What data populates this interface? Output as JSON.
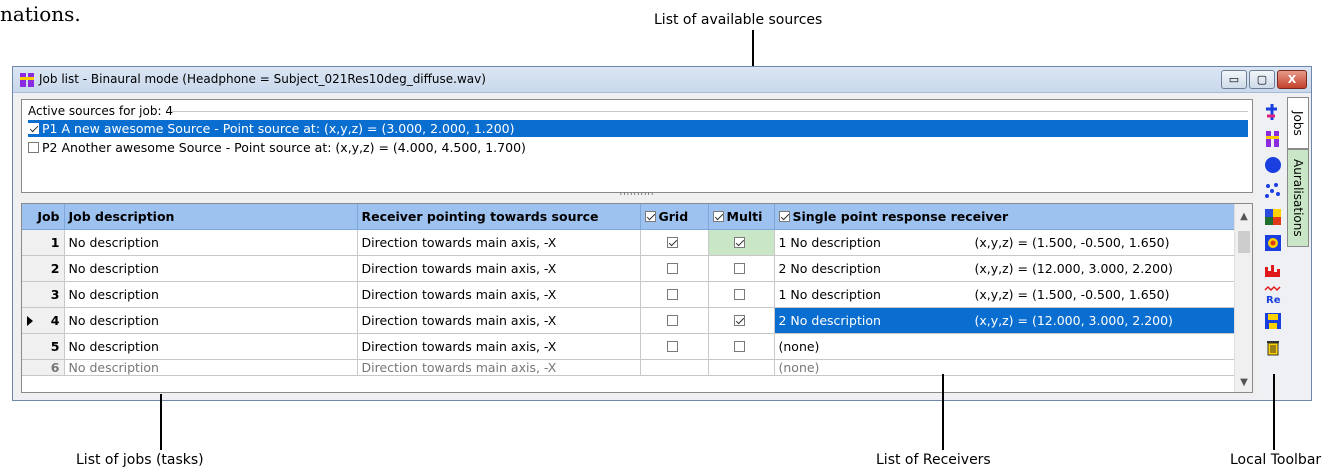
{
  "page": {
    "top_text": "nations."
  },
  "callouts": {
    "sources": "List of available sources",
    "jobs": "List of jobs (tasks)",
    "receivers": "List of Receivers",
    "toolbar": "Local Toolbar"
  },
  "window": {
    "title": "Job list - Binaural mode (Headphone = Subject_021Res10deg_diffuse.wav)",
    "buttons": {
      "minimize": "▭",
      "maximize": "▢",
      "close": "X"
    }
  },
  "sources": {
    "header": "Active sources for job: 4",
    "items": [
      {
        "label": "P1 A new awesome Source  -  Point source at: (x,y,z) = (3.000, 2.000, 1.200)",
        "checked": true,
        "selected": true
      },
      {
        "label": "P2 Another awesome Source  -  Point source at: (x,y,z) = (4.000, 4.500, 1.700)",
        "checked": false,
        "selected": false
      }
    ]
  },
  "splitter": "''''''''''",
  "grid": {
    "columns": {
      "job": "Job",
      "description": "Job description",
      "pointing": "Receiver pointing towards source",
      "grid": "Grid",
      "multi": "Multi",
      "single": "Single point response receiver"
    },
    "rows": [
      {
        "job": "1",
        "description": "No description",
        "pointing": "Direction towards main axis, -X",
        "grid": true,
        "multi": true,
        "receiver": "1 No description",
        "coords": "(x,y,z) = (1.500, -0.500, 1.650)"
      },
      {
        "job": "2",
        "description": "No description",
        "pointing": "Direction towards main axis, -X",
        "grid": false,
        "multi": false,
        "receiver": "2 No description",
        "coords": "(x,y,z) = (12.000, 3.000, 2.200)"
      },
      {
        "job": "3",
        "description": "No description",
        "pointing": "Direction towards main axis, -X",
        "grid": false,
        "multi": false,
        "receiver": "1 No description",
        "coords": "(x,y,z) = (1.500, -0.500, 1.650)"
      },
      {
        "job": "4",
        "description": "No description",
        "pointing": "Direction towards main axis, -X",
        "grid": false,
        "multi": true,
        "receiver": "2 No description",
        "coords": "(x,y,z) = (12.000, 3.000, 2.200)"
      },
      {
        "job": "5",
        "description": "No description",
        "pointing": "Direction towards main axis, -X",
        "grid": false,
        "multi": false,
        "receiver": "(none)",
        "coords": ""
      }
    ],
    "partial_row": {
      "job": "6",
      "description": "No description",
      "pointing": "Direction towards main axis, -X",
      "receiver": "(none)"
    }
  },
  "tabs": {
    "jobs": "Jobs",
    "auralisations": "Auralisations"
  },
  "colors": {
    "selection": "#0a6ed1",
    "header": "#9ec2f0",
    "multi_highlight": "#c9e7c6"
  },
  "toolbar_icons": [
    "add-job-icon",
    "job-list-icon",
    "blue-circle-icon",
    "dots-icon",
    "grid-map-icon",
    "color-map-icon",
    "histogram-icon",
    "re-wave-icon",
    "save-icon",
    "trash-icon"
  ]
}
